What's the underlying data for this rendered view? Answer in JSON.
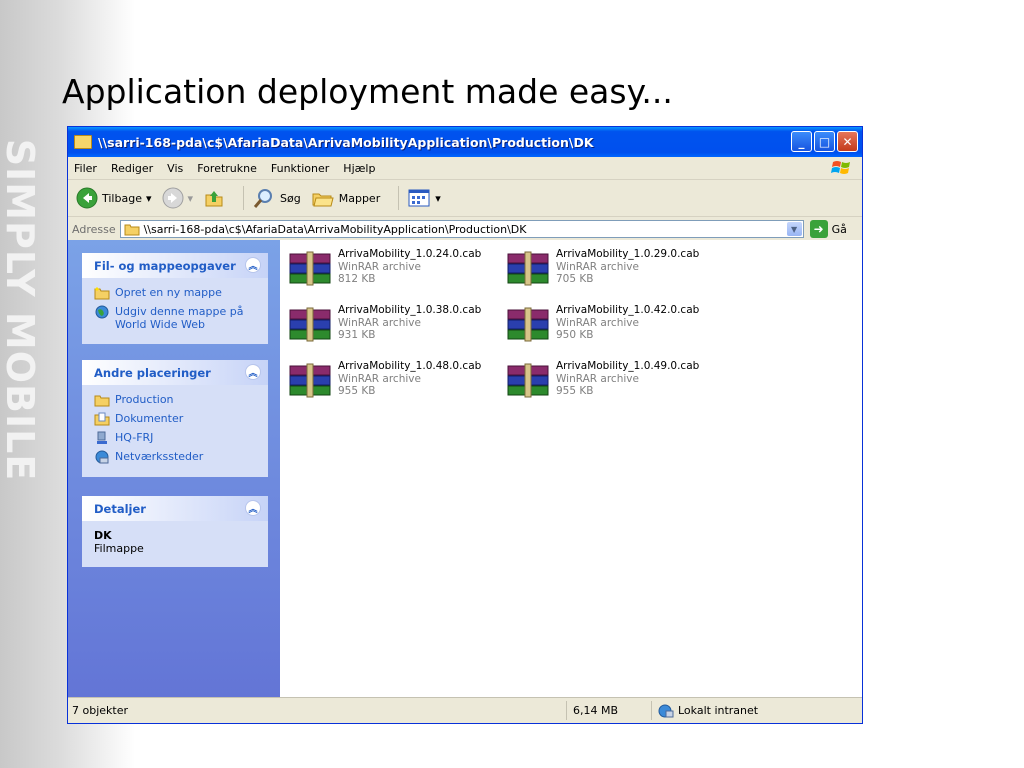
{
  "slide": {
    "title": "Application deployment made easy...",
    "side_text": "SIMPLY MOBILE"
  },
  "window": {
    "title": "\\\\sarri-168-pda\\c$\\AfariaData\\ArrivaMobilityApplication\\Production\\DK",
    "controls": {
      "minimize": "_",
      "maximize": "□",
      "close": "✕"
    }
  },
  "menu": [
    "Filer",
    "Rediger",
    "Vis",
    "Foretrukne",
    "Funktioner",
    "Hjælp"
  ],
  "toolbar": {
    "back_label": "Tilbage",
    "search_label": "Søg",
    "folders_label": "Mapper"
  },
  "address": {
    "label": "Adresse",
    "value": "\\\\sarri-168-pda\\c$\\AfariaData\\ArrivaMobilityApplication\\Production\\DK",
    "go_label": "Gå"
  },
  "tasks": {
    "file_tasks": {
      "title": "Fil- og mappeopgaver",
      "items": [
        "Opret en ny mappe",
        "Udgiv denne mappe på World Wide Web"
      ]
    },
    "other_places": {
      "title": "Andre placeringer",
      "items": [
        "Production",
        "Dokumenter",
        "HQ-FRJ",
        "Netværkssteder"
      ]
    },
    "details": {
      "title": "Detaljer",
      "name": "DK",
      "type": "Filmappe"
    }
  },
  "files": [
    {
      "name": "ArrivaMobility_1.0.24.0.cab",
      "type": "WinRAR archive",
      "size": "812 KB"
    },
    {
      "name": "ArrivaMobility_1.0.29.0.cab",
      "type": "WinRAR archive",
      "size": "705 KB"
    },
    {
      "name": "ArrivaMobility_1.0.38.0.cab",
      "type": "WinRAR archive",
      "size": "931 KB"
    },
    {
      "name": "ArrivaMobility_1.0.42.0.cab",
      "type": "WinRAR archive",
      "size": "950 KB"
    },
    {
      "name": "ArrivaMobility_1.0.48.0.cab",
      "type": "WinRAR archive",
      "size": "955 KB"
    },
    {
      "name": "ArrivaMobility_1.0.49.0.cab",
      "type": "WinRAR archive",
      "size": "955 KB"
    }
  ],
  "status": {
    "count": "7 objekter",
    "size": "6,14 MB",
    "zone": "Lokalt intranet"
  }
}
